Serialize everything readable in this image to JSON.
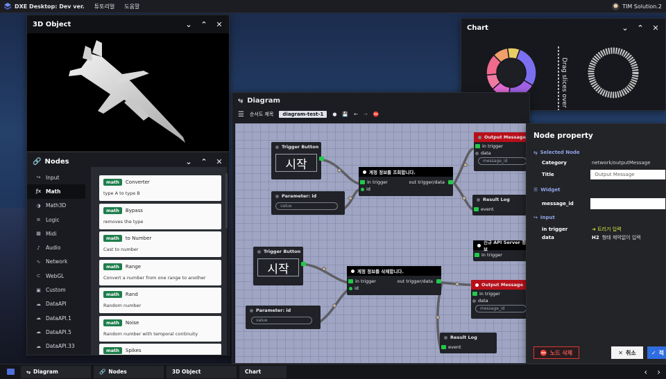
{
  "topbar": {
    "title": "DXE Desktop: Dev ver.",
    "menus": [
      "튜토리얼",
      "도움말"
    ],
    "user": "TIM Solution.2"
  },
  "panel_3d": {
    "title": "3D Object"
  },
  "nodes_panel": {
    "title": "Nodes",
    "categories": [
      {
        "label": "Input",
        "icon": "input-icon"
      },
      {
        "label": "Math",
        "icon": "math-icon",
        "active": true
      },
      {
        "label": "Math3D",
        "icon": "math3d-icon"
      },
      {
        "label": "Logic",
        "icon": "logic-icon"
      },
      {
        "label": "Midi",
        "icon": "midi-icon"
      },
      {
        "label": "Audio",
        "icon": "audio-icon"
      },
      {
        "label": "Network",
        "icon": "network-icon"
      },
      {
        "label": "WebGL",
        "icon": "webgl-icon"
      },
      {
        "label": "Custom",
        "icon": "custom-icon"
      },
      {
        "label": "DataAPI",
        "icon": "cloud-icon"
      },
      {
        "label": "DataAPI.1",
        "icon": "cloud-icon"
      },
      {
        "label": "DataAPI.5",
        "icon": "cloud-icon"
      },
      {
        "label": "DataAPI.33",
        "icon": "cloud-icon"
      }
    ],
    "cards": [
      {
        "tag": "math",
        "name": "Converter",
        "desc": "type A to type B"
      },
      {
        "tag": "math",
        "name": "Bypass",
        "desc": "removes the type"
      },
      {
        "tag": "math",
        "name": "to Number",
        "desc": "Cast to number"
      },
      {
        "tag": "math",
        "name": "Range",
        "desc": "Convert a number from one range to another"
      },
      {
        "tag": "math",
        "name": "Rand",
        "desc": "Random number"
      },
      {
        "tag": "math",
        "name": "Noise",
        "desc": "Random number with temporal continuity"
      },
      {
        "tag": "math",
        "name": "Spikes",
        "desc": ""
      }
    ]
  },
  "chart_panel": {
    "title": "Chart",
    "side_label": "Drag slices over",
    "chart_data": {
      "type": "pie",
      "values": [
        28,
        18,
        12,
        10,
        14,
        10,
        8
      ],
      "colors": [
        "#7b6ff0",
        "#a362e8",
        "#e26bd6",
        "#f07aa0",
        "#ef6a8c",
        "#f1a06b",
        "#e8cc62"
      ]
    }
  },
  "diagram": {
    "title": "Diagram",
    "flow_label": "순서도 제목",
    "flow_name": "diagram-test-1",
    "nodes": {
      "trigger1": {
        "title": "Trigger Button",
        "button": "시작"
      },
      "param1": {
        "title": "Parameter: id",
        "placeholder": "value"
      },
      "query": {
        "title": "계정 정보를 조회합니다.",
        "in": "in trigger",
        "id": "id",
        "out": "out trigger/data"
      },
      "output1": {
        "title": "Output Message",
        "in": "in trigger",
        "data": "data",
        "field": "message_id"
      },
      "result1": {
        "title": "Result Log",
        "event": "event"
      },
      "trigger2": {
        "title": "Trigger Button",
        "button": "시작"
      },
      "param2": {
        "title": "Parameter: id",
        "placeholder": "value"
      },
      "delete": {
        "title": "계정 정보를 삭제합니다.",
        "in": "in trigger",
        "id": "id",
        "out": "out trigger/data"
      },
      "newapi": {
        "title": "신규 API Server 정보",
        "in": "in trigger"
      },
      "output2": {
        "title": "Output Message",
        "in": "in trigger",
        "data": "data",
        "field": "message_id"
      },
      "result2": {
        "title": "Result Log",
        "event": "event"
      }
    }
  },
  "property": {
    "title": "Node property",
    "selected_label": "Selected Node",
    "category_key": "Category",
    "category_val": "network/outputMessage",
    "title_key": "Title",
    "title_val": "Output Message",
    "widget_label": "Widget",
    "message_key": "message_id",
    "input_label": "Input",
    "in_trigger_key": "in trigger",
    "in_trigger_val": "트리거 입력",
    "data_key": "data",
    "data_tag": "H2",
    "data_val": "형태 제약없이 입력",
    "delete_label": "노드 삭제",
    "cancel_label": "취소",
    "confirm_label": "적"
  },
  "taskbar": {
    "tabs": [
      {
        "label": "Diagram",
        "icon": "diagram-icon"
      },
      {
        "label": "Nodes",
        "icon": "link-icon"
      },
      {
        "label": "3D Object",
        "icon": ""
      },
      {
        "label": "Chart",
        "icon": ""
      }
    ]
  }
}
